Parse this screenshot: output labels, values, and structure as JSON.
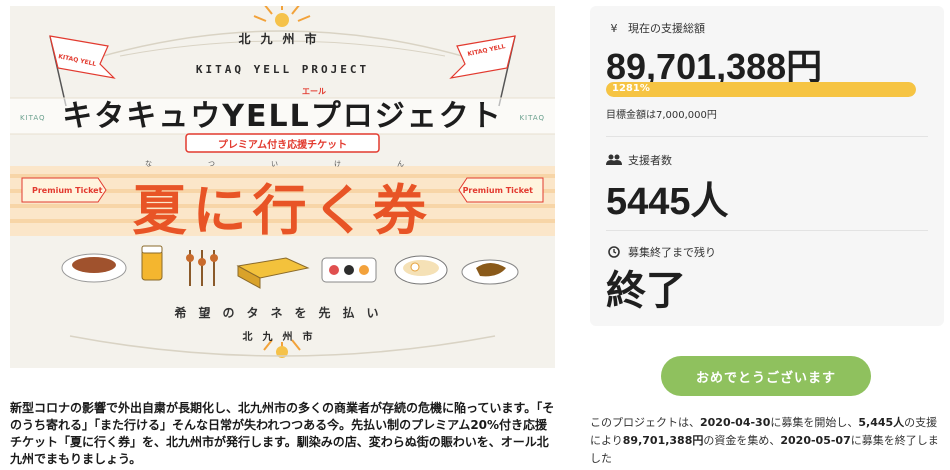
{
  "hero": {
    "city_top": "北九州市",
    "project_en": "KITAQ YELL PROJECT",
    "project_title": "キタキュウYELLプロジェクト",
    "yell_ruby": "エール",
    "kitaq_left": "KITAQ",
    "kitaq_right": "KITAQ",
    "premium_band": "プレミアム付き応援チケット",
    "ruby": "なついけん",
    "main_title": "夏に行く券",
    "premium_left": "Premium Ticket",
    "premium_right": "Premium Ticket",
    "tagline": "希望のタネを先払い",
    "city_bottom": "北九州市",
    "flag_text": "KITAQ YELL PROJECT"
  },
  "description": "新型コロナの影響で外出自粛が長期化し、北九州市の多くの商業者が存続の危機に陥っています。「そのうち寄れる」「また行ける」そんな日常が失われつつある今。先払い制のプレミアム20%付き応援チケット「夏に行く券」を、北九州市が発行します。馴染みの店、変わらぬ街の賑わいを、オール北九州でまもりましょう。",
  "stats": {
    "total": {
      "icon": "yen-icon",
      "icon_glyph": "¥",
      "label": "現在の支援総額",
      "value": "89,701,388円",
      "progress_percent": 100,
      "progress_label": "1281%",
      "goal": "目標金額は7,000,000円"
    },
    "supporters": {
      "icon": "users-icon",
      "label": "支援者数",
      "value": "5445人"
    },
    "remaining": {
      "icon": "clock-icon",
      "label": "募集終了まで残り",
      "value": "終了"
    }
  },
  "congrats_button": "おめでとうございます",
  "summary": {
    "p1": "このプロジェクトは、",
    "start_date": "2020-04-30",
    "p2": "に募集を開始し、",
    "supporters": "5,445人",
    "p3": "の支援により",
    "amount": "89,701,388円",
    "p4": "の資金を集め、",
    "end_date": "2020-05-07",
    "p5": "に募集を終了しました"
  },
  "colors": {
    "accent_orange": "#e85426",
    "progress_yellow": "#f6c443",
    "button_green": "#8fc15e",
    "banner_bg": "#f4f2ec"
  }
}
